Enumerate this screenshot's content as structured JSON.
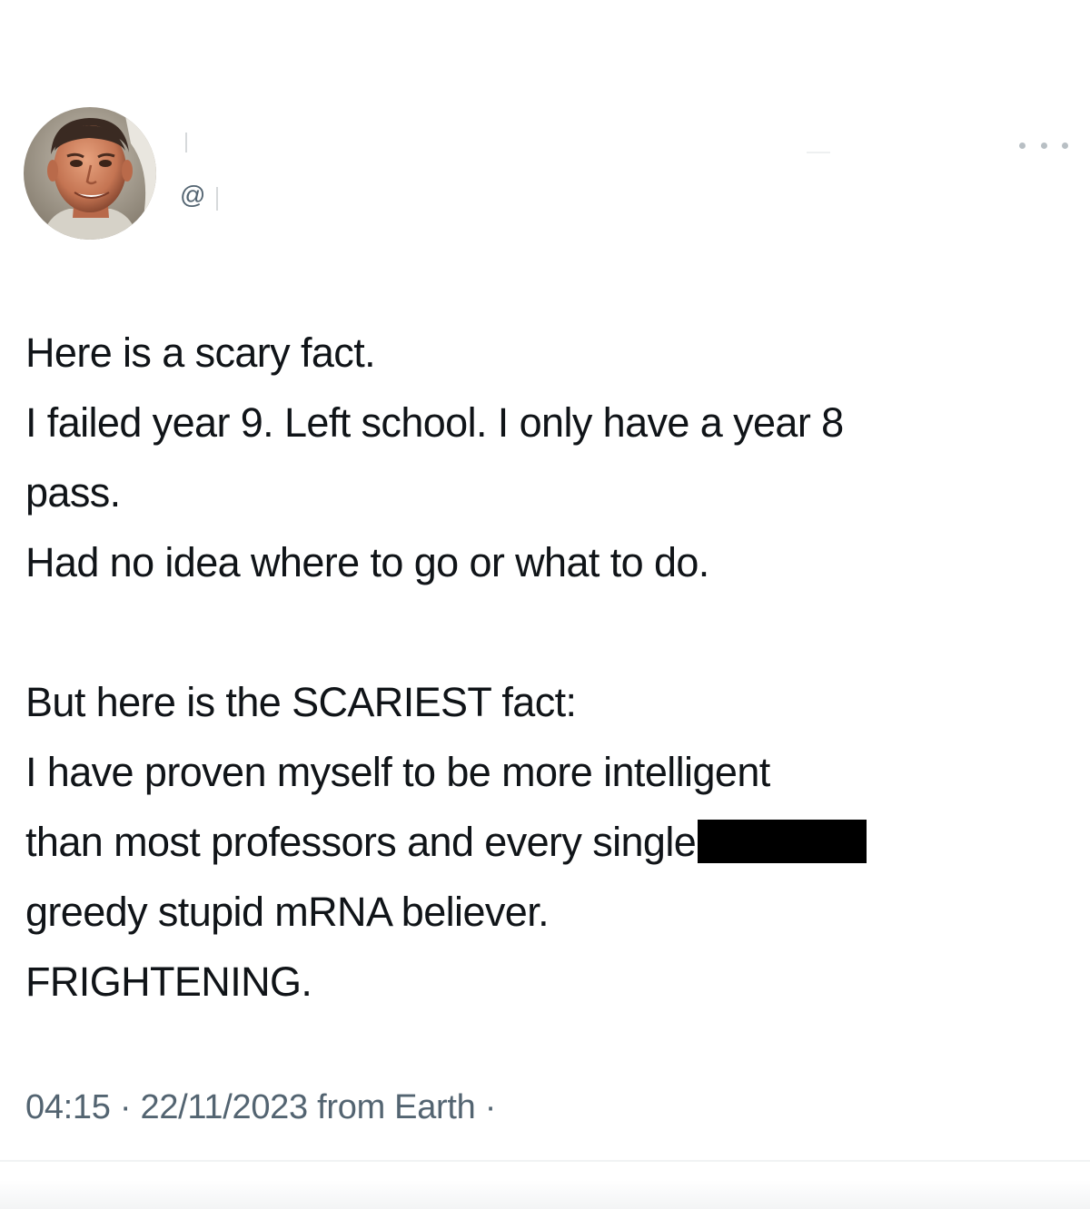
{
  "tweet": {
    "handle": "@",
    "avatar_icon": "user-avatar-photo",
    "more_icon": "more-options-icon",
    "body_lines": [
      "Here is a scary fact.",
      "I failed year 9. Left school. I only have a year 8",
      "pass.",
      "Had no idea where to go or what to do.",
      "",
      "But here is the SCARIEST fact:",
      "I have proven myself to be more intelligent",
      "than most professors and every single",
      "greedy stupid mRNA believer.",
      "FRIGHTENING."
    ],
    "time": "04:15",
    "separator": "·",
    "date": "22/11/2023",
    "source": "from Earth",
    "trailing_separator": "·"
  }
}
